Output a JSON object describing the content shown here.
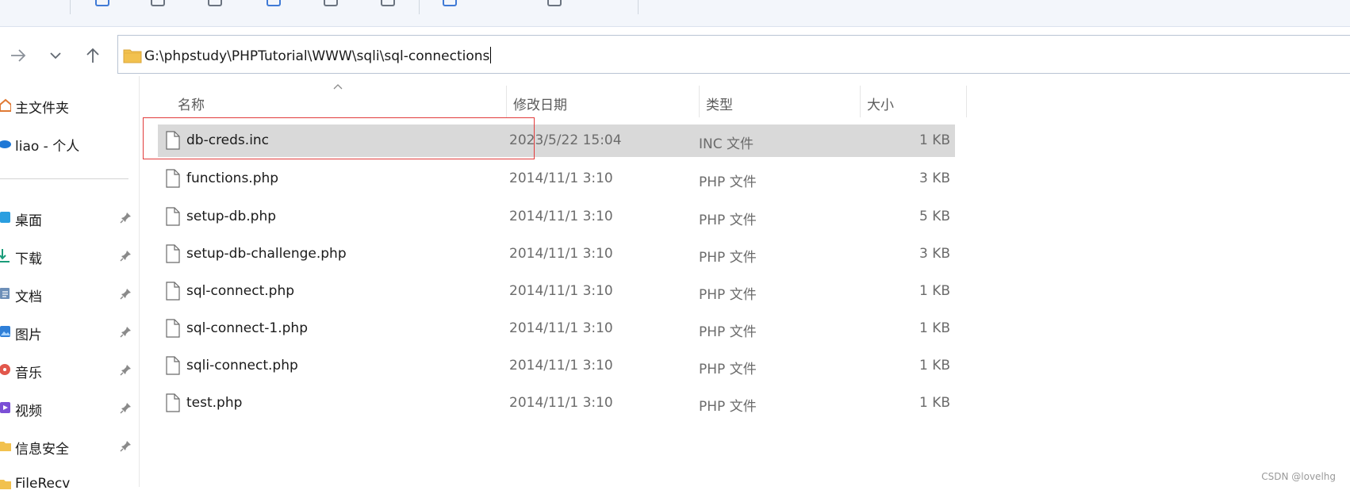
{
  "address_bar": {
    "path": "G:\\phpstudy\\PHPTutorial\\WWW\\sqli\\sql-connections"
  },
  "sidebar": {
    "items": [
      {
        "label": "主文件夹",
        "icon": "home-icon",
        "pinned": false
      },
      {
        "label": "liao - 个人",
        "icon": "onedrive-cloud-icon",
        "pinned": false
      },
      {
        "label": "桌面",
        "icon": "desktop-icon",
        "pinned": true
      },
      {
        "label": "下载",
        "icon": "download-icon",
        "pinned": true
      },
      {
        "label": "文档",
        "icon": "documents-icon",
        "pinned": true
      },
      {
        "label": "图片",
        "icon": "pictures-icon",
        "pinned": true
      },
      {
        "label": "音乐",
        "icon": "music-icon",
        "pinned": true
      },
      {
        "label": "视频",
        "icon": "videos-icon",
        "pinned": true
      },
      {
        "label": "信息安全",
        "icon": "folder-icon",
        "pinned": true
      },
      {
        "label": "FileRecv",
        "icon": "folder-icon",
        "pinned": false
      }
    ]
  },
  "columns": {
    "name": "名称",
    "date": "修改日期",
    "type": "类型",
    "size": "大小"
  },
  "files": [
    {
      "name": "db-creds.inc",
      "date": "2023/5/22 15:04",
      "type": "INC 文件",
      "size": "1 KB",
      "selected": true
    },
    {
      "name": "functions.php",
      "date": "2014/11/1 3:10",
      "type": "PHP 文件",
      "size": "3 KB"
    },
    {
      "name": "setup-db.php",
      "date": "2014/11/1 3:10",
      "type": "PHP 文件",
      "size": "5 KB"
    },
    {
      "name": "setup-db-challenge.php",
      "date": "2014/11/1 3:10",
      "type": "PHP 文件",
      "size": "3 KB"
    },
    {
      "name": "sql-connect.php",
      "date": "2014/11/1 3:10",
      "type": "PHP 文件",
      "size": "1 KB"
    },
    {
      "name": "sql-connect-1.php",
      "date": "2014/11/1 3:10",
      "type": "PHP 文件",
      "size": "1 KB"
    },
    {
      "name": "sqli-connect.php",
      "date": "2014/11/1 3:10",
      "type": "PHP 文件",
      "size": "1 KB"
    },
    {
      "name": "test.php",
      "date": "2014/11/1 3:10",
      "type": "PHP 文件",
      "size": "1 KB"
    }
  ],
  "watermark": "CSDN @lovelhg",
  "colors": {
    "selection": "#d9d9d9",
    "highlight_box": "#e23b3b",
    "folder": "#f2c14e"
  }
}
